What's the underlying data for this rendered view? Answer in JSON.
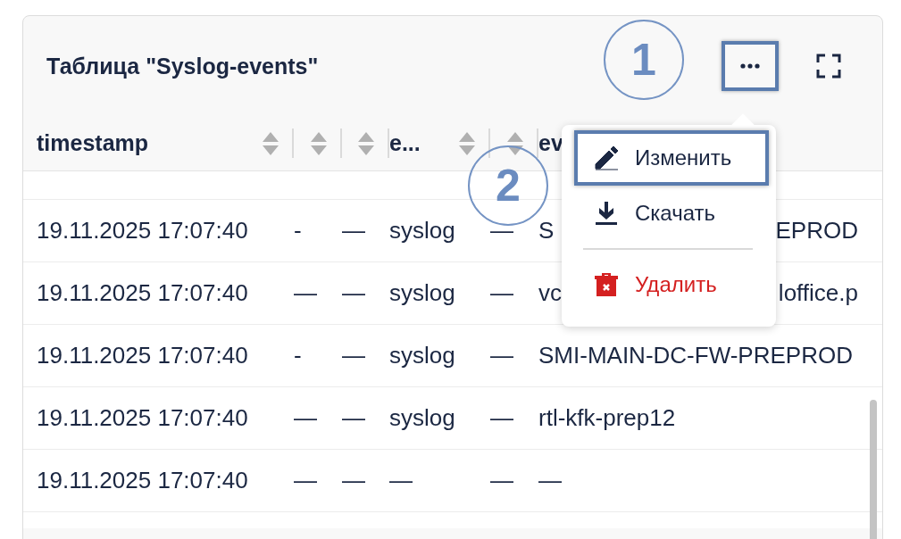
{
  "card": {
    "title": "Таблица \"Syslog-events\"",
    "more_button": {
      "highlighted": true
    }
  },
  "annotations": [
    {
      "label": "1"
    },
    {
      "label": "2"
    }
  ],
  "table": {
    "columns": [
      {
        "label": "timestamp"
      },
      {},
      {},
      {
        "label": "e..."
      },
      {},
      {
        "label": "ev"
      }
    ],
    "rows": [
      {
        "cells": [
          {
            "text": "19.11.2025 17:07:40"
          },
          {
            "text": "-"
          },
          {
            "text": "—"
          },
          {
            "text": "syslog"
          },
          {
            "text": "—"
          },
          {
            "start": "S",
            "end": "EPROD"
          }
        ]
      },
      {
        "cells": [
          {
            "text": "19.11.2025 17:07:40"
          },
          {
            "text": "—"
          },
          {
            "text": "—"
          },
          {
            "text": "syslog"
          },
          {
            "text": "—"
          },
          {
            "start": "vc",
            "end": "loffice.p"
          }
        ]
      },
      {
        "cells": [
          {
            "text": "19.11.2025 17:07:40"
          },
          {
            "text": "-"
          },
          {
            "text": "—"
          },
          {
            "text": "syslog"
          },
          {
            "text": "—"
          },
          {
            "text": "SMI-MAIN-DC-FW-PREPROD"
          }
        ]
      },
      {
        "cells": [
          {
            "text": "19.11.2025 17:07:40"
          },
          {
            "text": "—"
          },
          {
            "text": "—"
          },
          {
            "text": "syslog"
          },
          {
            "text": "—"
          },
          {
            "text": "rtl-kfk-prep12"
          }
        ]
      },
      {
        "cells": [
          {
            "text": "19.11.2025 17:07:40"
          },
          {
            "text": "—"
          },
          {
            "text": "—"
          },
          {
            "text": "—"
          },
          {
            "text": "—"
          },
          {
            "text": "—"
          }
        ]
      }
    ]
  },
  "menu": {
    "items": [
      {
        "kind": "edit",
        "label": "Изменить",
        "highlighted": true
      },
      {
        "kind": "download",
        "label": "Скачать",
        "highlighted": false
      },
      {
        "kind": "delete",
        "label": "Удалить",
        "highlighted": false
      }
    ]
  }
}
